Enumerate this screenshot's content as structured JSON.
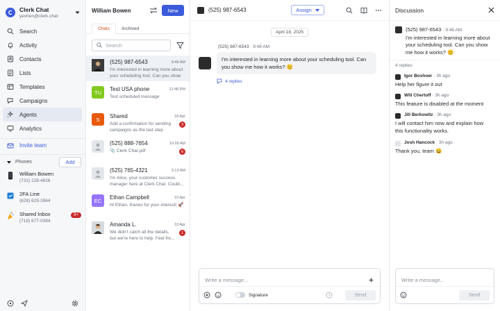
{
  "workspace": {
    "name": "Clerk Chat",
    "email": "yevhen@clerk.chat"
  },
  "nav": [
    {
      "label": "Search",
      "icon": "search-icon"
    },
    {
      "label": "Activity",
      "icon": "activity-icon"
    },
    {
      "label": "Contacts",
      "icon": "contacts-icon"
    },
    {
      "label": "Lists",
      "icon": "lists-icon"
    },
    {
      "label": "Templates",
      "icon": "templates-icon"
    },
    {
      "label": "Campaigns",
      "icon": "campaigns-icon"
    },
    {
      "label": "Agents",
      "icon": "agents-icon"
    },
    {
      "label": "Analytics",
      "icon": "analytics-icon"
    }
  ],
  "invite_label": "Invite team",
  "phones": {
    "label": "Phones",
    "add_label": "Add",
    "items": [
      {
        "name": "William Bowen",
        "number": "(732) 228-4826",
        "badge": ""
      },
      {
        "name": "2FA Line",
        "number": "(628) 629-3964",
        "badge": ""
      },
      {
        "name": "Shared Inbox",
        "number": "(719) 677-0384",
        "badge": "9+"
      }
    ]
  },
  "list": {
    "title": "William Bowen",
    "new_label": "New",
    "tabs": [
      "Chats",
      "Archived"
    ],
    "search_placeholder": "Search",
    "conversations": [
      {
        "name": "(525) 987-6543",
        "time": "9:48 AM",
        "preview": "I'm interested in learning more about your scheduling tool. Can you show me how it works?",
        "badge": "",
        "avatar": "photo",
        "initials": ""
      },
      {
        "name": "Test USA phone",
        "time": "12:48 PM",
        "preview": "Test scheduled message",
        "badge": "",
        "avatar": "initials",
        "initials": "TU",
        "color": "#82c91e"
      },
      {
        "name": "Shared",
        "time": "18 Apr",
        "preview": "Add a confirmation for sending campaigns as the last step",
        "badge": "3",
        "avatar": "initials",
        "initials": "S",
        "color": "#e8590c"
      },
      {
        "name": "(525) 888-7654",
        "time": "10:28 AM",
        "preview": "📎 Clerk Chat.pdf",
        "badge": "6",
        "avatar": "placeholder",
        "initials": ""
      },
      {
        "name": "(525) 765-4321",
        "time": "3:13 AM",
        "preview": "I'm Alice, your customer success manager here at Clerk Chat. Could...",
        "badge": "",
        "avatar": "placeholder",
        "initials": ""
      },
      {
        "name": "Ethan Campbell",
        "time": "10 Apr",
        "preview": "Hi Ethan, thanks for your interest! 🚀",
        "badge": "",
        "avatar": "initials",
        "initials": "EC",
        "color": "#9775fa"
      },
      {
        "name": "Amanda L.",
        "time": "10 Apr",
        "preview": "We didn't catch all the details, but we're here to help. Feel fre...",
        "badge": "1",
        "avatar": "photo",
        "initials": ""
      }
    ]
  },
  "chat": {
    "title": "(525) 987-6543",
    "assign_label": "Assign",
    "date": "April 18, 2025",
    "message": {
      "sender": "(525) 987-6543",
      "time": "9:48 AM",
      "text": "I'm interested in learning more about your scheduling tool. Can you show me how it works? 😊",
      "replies": "4 replies"
    },
    "composer_placeholder": "Write a message...",
    "signature_label": "Signature",
    "send_label": "Send"
  },
  "discussion": {
    "title": "Discussion",
    "root": {
      "sender": "(525) 987-6543",
      "time": "9:48 AM",
      "text": "I'm interested in learning more about your scheduling tool. Can you show me how it works? 😊"
    },
    "replies_count": "4 replies",
    "replies": [
      {
        "name": "Igor Boshoer",
        "time": "3h ago",
        "text": "Help her figure it out",
        "avatar": "photo"
      },
      {
        "name": "Will Chertoff",
        "time": "3h ago",
        "text": "This feature is disabled at the moment",
        "avatar": "photo"
      },
      {
        "name": "Jill Berkowitz",
        "time": "3h ago",
        "text": "I will contact him now and explain how this functionality works.",
        "avatar": "photo"
      },
      {
        "name": "Josh Hancock",
        "time": "3h ago",
        "text": "Thank you, team 😄",
        "avatar": "placeholder"
      }
    ],
    "composer_placeholder": "Write a message...",
    "send_label": "Send"
  },
  "colors": {
    "accent": "#3b5bdb",
    "badge": "#c92a2a",
    "tab_active": "#d9480f"
  }
}
